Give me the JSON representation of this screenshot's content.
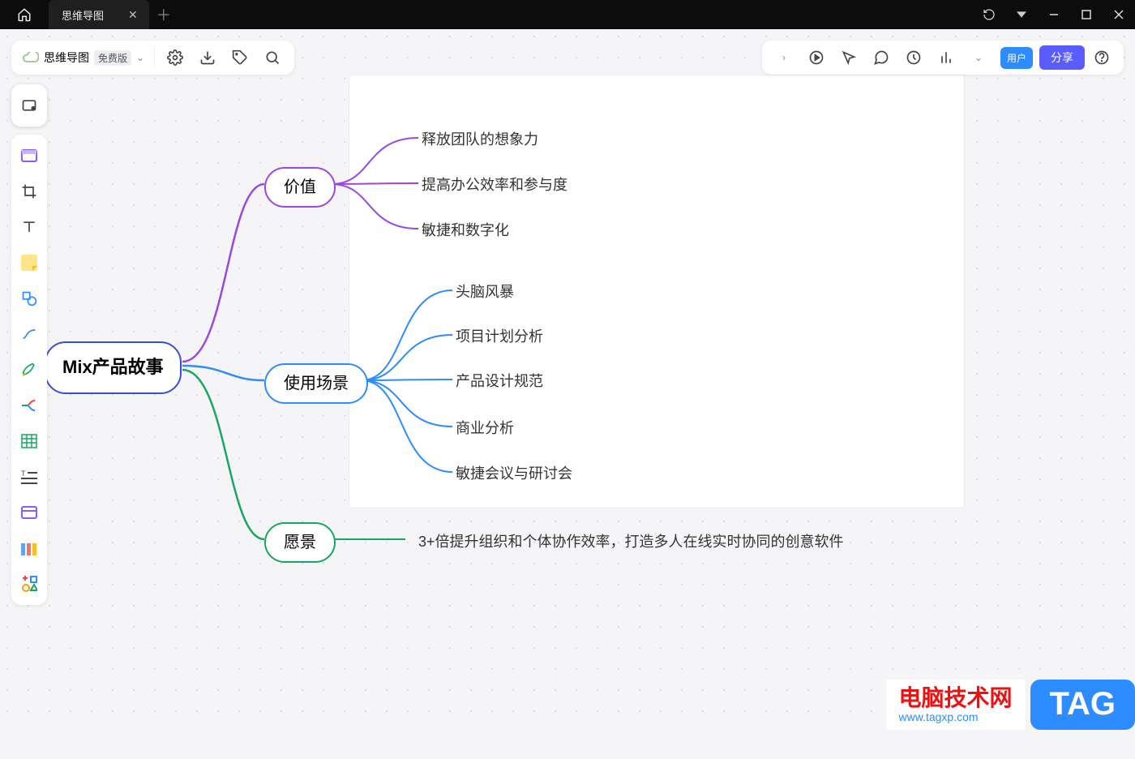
{
  "titlebar": {
    "tab_title": "思维导图"
  },
  "toolbar_left": {
    "doc_label": "思维导图",
    "version_badge": "免费版"
  },
  "toolbar_right": {
    "user_btn": "用户",
    "share_btn": "分享"
  },
  "mindmap": {
    "root": "Mix产品故事",
    "branches": [
      {
        "label": "价值",
        "color": "#9c48e0",
        "children": [
          "释放团队的想象力",
          "提高办公效率和参与度",
          "敏捷和数字化"
        ]
      },
      {
        "label": "使用场景",
        "color": "#2d8cff",
        "children": [
          "头脑风暴",
          "项目计划分析",
          "产品设计规范",
          "商业分析",
          "敏捷会议与研讨会"
        ]
      },
      {
        "label": "愿景",
        "color": "#16a860",
        "children": [
          "3+倍提升组织和个体协作效率，打造多人在线实时协同的创意软件"
        ]
      }
    ]
  },
  "watermark": {
    "line1": "电脑技术网",
    "url": "www.tagxp.com",
    "tag": "TAG"
  }
}
